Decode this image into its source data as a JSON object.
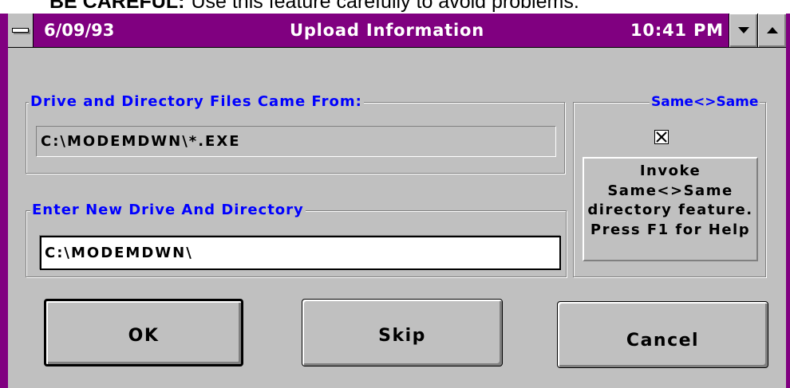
{
  "note": {
    "emphasis": "BE CAREFUL:",
    "text": "Use this feature carefully to avoid problems."
  },
  "window": {
    "date": "6/09/93",
    "title": "Upload Information",
    "time": "10:41 PM",
    "icons": {
      "system_menu": "system-menu-icon",
      "minimize": "minimize-arrow-icon",
      "maximize": "maximize-arrow-icon"
    },
    "colors": {
      "title_bar": "#800080",
      "title_text": "#ffffff",
      "face": "#c0c0c0",
      "group_label": "#0000ff",
      "input_background": "#ffffff"
    }
  },
  "source_group": {
    "label": "Drive and Directory Files Came From:",
    "value": "C:\\MODEMDWN\\*.EXE"
  },
  "target_group": {
    "label": "Enter New Drive And Directory",
    "value": "C:\\MODEMDWN\\"
  },
  "same_group": {
    "label": "Same<>Same",
    "checked": true,
    "checkbox_icon": "check-x-icon",
    "help_lines": [
      "Invoke",
      "Same<>Same",
      "directory feature.",
      "Press F1 for Help"
    ]
  },
  "buttons": {
    "ok": "OK",
    "skip": "Skip",
    "cancel": "Cancel"
  }
}
